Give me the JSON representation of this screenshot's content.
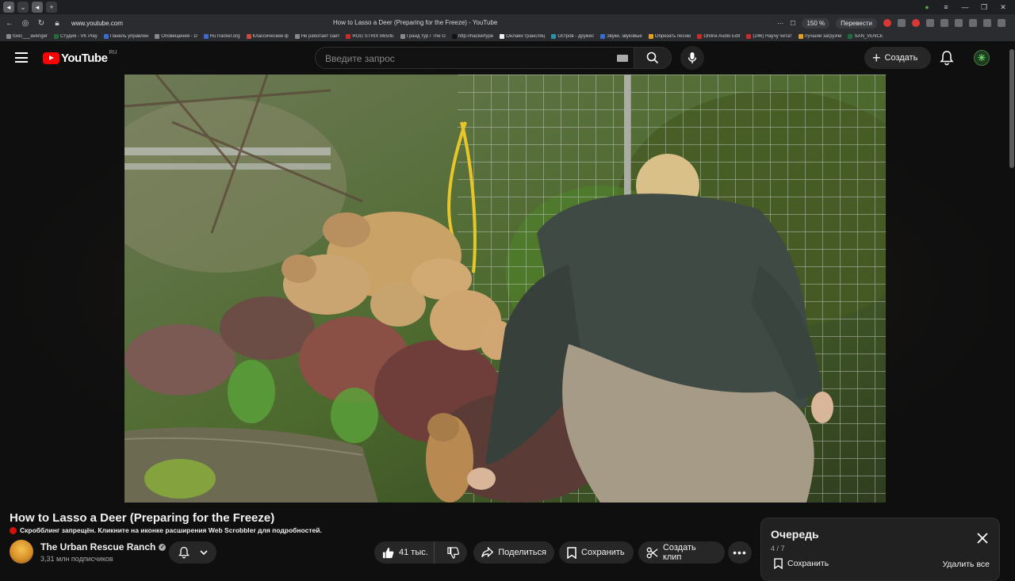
{
  "browser": {
    "url": "www.youtube.com",
    "tab_title": "How to Lasso a Deer (Preparing for the Freeze) - YouTube",
    "zoom": "150 %",
    "translate_label": "Перевести",
    "bookmarks": [
      "toxic___avenger",
      "Студия - VK Play",
      "Панель управлен",
      "Оповещения - D",
      "RuTracker.org",
      "Классический ф",
      "Не работает сайт",
      "ROG STRIX B650E",
      "Гранд тур / The G",
      "http://hackertype",
      "Онлайн трансляц",
      "Остров - дружес",
      "Звуки, звуковые",
      "Обрезать песню",
      "Online Audio Edit",
      "(246) Научу читат",
      "Лучший загрузчи",
      "SAN_VENCE"
    ]
  },
  "masthead": {
    "logo_text": "YouTube",
    "region": "RU",
    "search_placeholder": "Введите запрос",
    "create_label": "Создать"
  },
  "video": {
    "title": "How to Lasso a Deer (Preparing for the Freeze)",
    "scrobble_notice": "Скробблинг запрещён. Кликните на иконке расширения Web Scrobbler для подробностей."
  },
  "channel": {
    "name": "The Urban Rescue Ranch",
    "subscribers": "3,31 млн подписчиков"
  },
  "actions": {
    "likes": "41 тыс.",
    "share": "Поделиться",
    "save": "Сохранить",
    "clip": "Создать клип"
  },
  "queue": {
    "title": "Очередь",
    "position": "4 / 7",
    "save_label": "Сохранить",
    "clear_label": "Удалить все"
  },
  "colors": {
    "background": "#0f0f0f",
    "brand_red": "#ff0000",
    "button_bg": "#272727"
  }
}
